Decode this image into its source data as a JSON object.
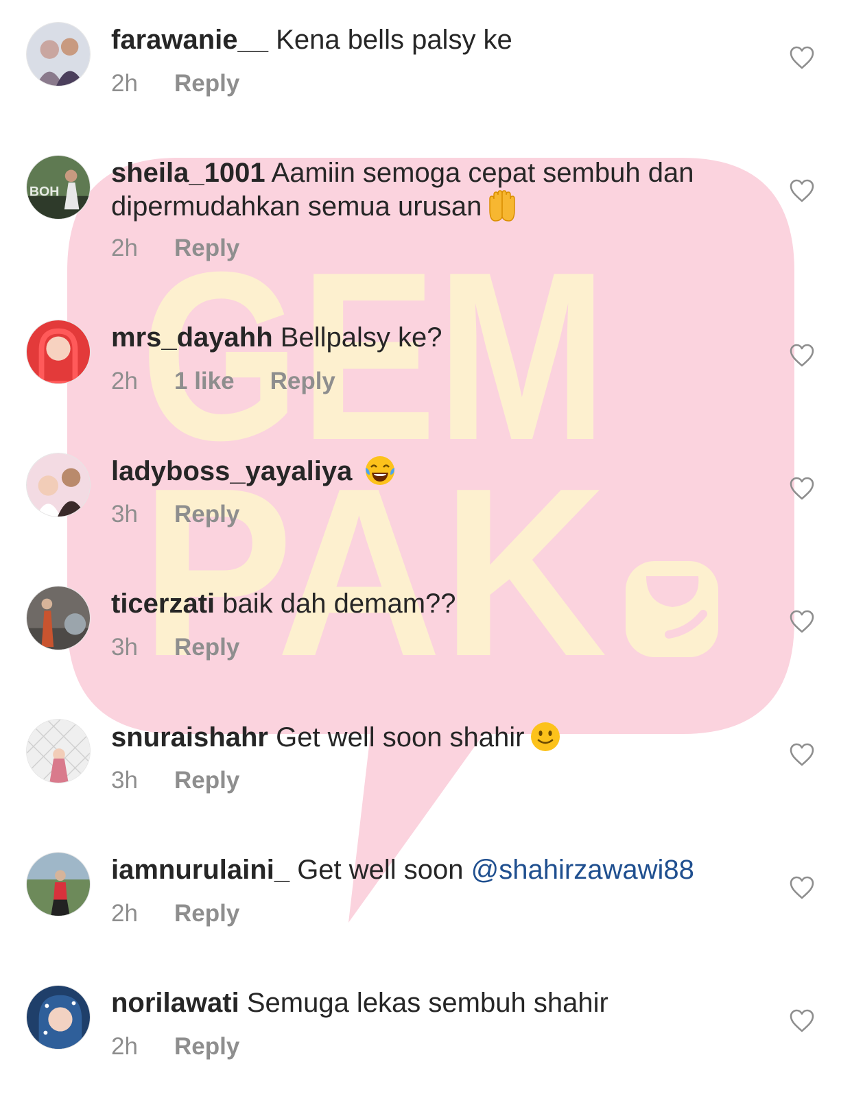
{
  "comments": [
    {
      "username": "farawanie__",
      "text": "Kena bells palsy ke",
      "time": "2h",
      "reply": "Reply",
      "avatar_colors": [
        "#d9dde6",
        "#8a7a8c"
      ]
    },
    {
      "username": "sheila_1001",
      "text": "Aamiin semoga cepat sembuh dan dipermudahkan semua urusan",
      "emoji": "raised-hands-emoji",
      "time": "2h",
      "reply": "Reply",
      "avatar_text": "BOH",
      "avatar_colors": [
        "#5f7a52",
        "#2e3a2a"
      ]
    },
    {
      "username": "mrs_dayahh",
      "text": "Bellpalsy ke?",
      "time": "2h",
      "likes": "1 like",
      "reply": "Reply",
      "avatar_colors": [
        "#e33a3a",
        "#f7d2c0"
      ]
    },
    {
      "username": "ladyboss_yayaliya",
      "text": "",
      "emoji": "tears-of-joy-emoji",
      "time": "3h",
      "reply": "Reply",
      "avatar_colors": [
        "#f3dbe3",
        "#3a2a2a"
      ]
    },
    {
      "username": "ticerzati",
      "text": "baik dah demam??",
      "time": "3h",
      "reply": "Reply",
      "avatar_colors": [
        "#6f6a66",
        "#c9542f"
      ]
    },
    {
      "username": "snuraishahr",
      "text": "Get well soon shahir",
      "emoji": "slightly-smiling-face-emoji",
      "time": "3h",
      "reply": "Reply",
      "avatar_colors": [
        "#efefef",
        "#d97a8c"
      ]
    },
    {
      "username": "iamnurulaini_",
      "text": "Get well soon",
      "mention": "@shahirzawawi88",
      "time": "2h",
      "reply": "Reply",
      "avatar_colors": [
        "#6d8a5a",
        "#d8323c"
      ]
    },
    {
      "username": "norilawati",
      "text": "Semuga lekas sembuh shahir",
      "time": "2h",
      "reply": "Reply",
      "avatar_colors": [
        "#2f5f9a",
        "#f2d2c2"
      ]
    }
  ],
  "watermark": {
    "line1": "GEM",
    "line2": "PAK",
    "bubble_color": "#fbd3de",
    "letter_color": "#fdf0cf"
  },
  "colors": {
    "text": "#262626",
    "meta": "#8e8e8e",
    "mention": "#1f4f8f"
  }
}
